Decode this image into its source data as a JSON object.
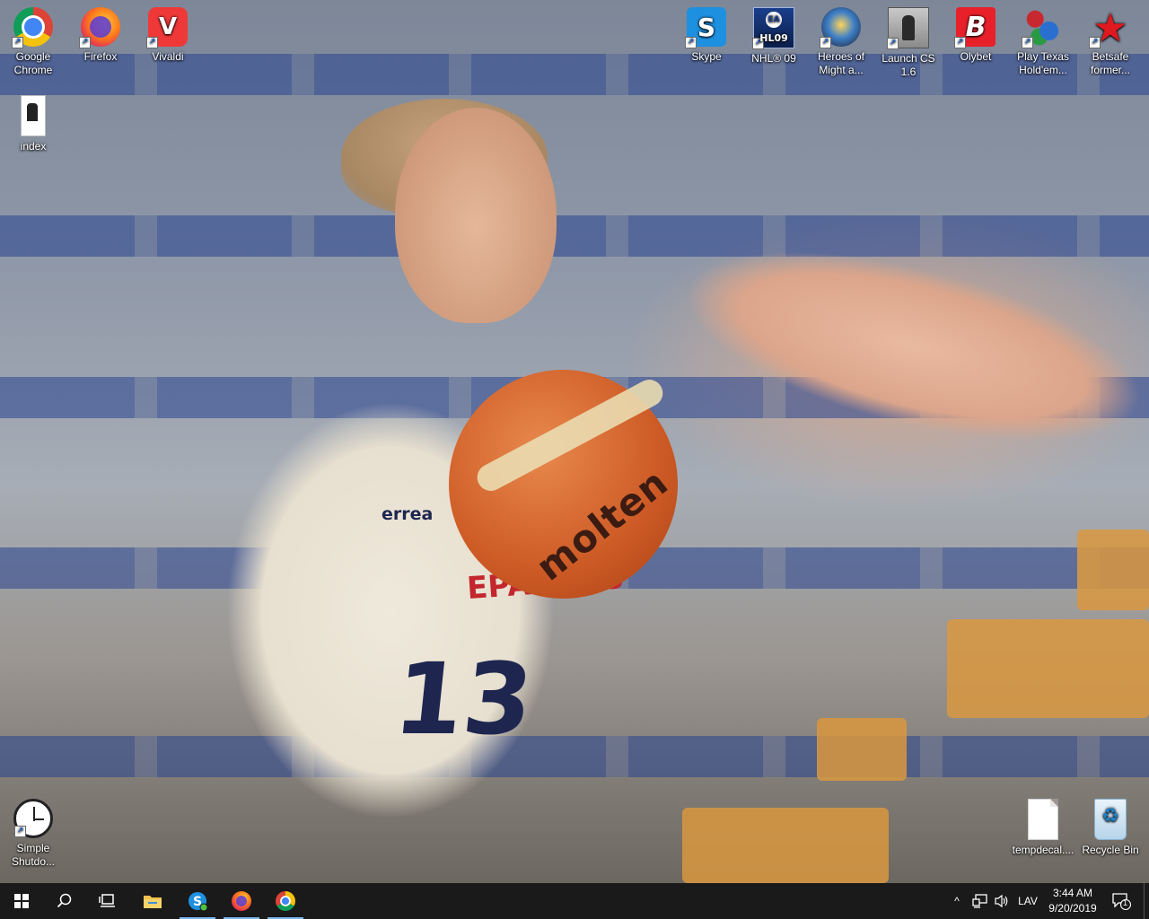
{
  "desktop": {
    "icons_top_left": [
      {
        "label": "Google Chrome",
        "icon": "chrome-icon"
      },
      {
        "label": "Firefox",
        "icon": "firefox-icon"
      },
      {
        "label": "Vivaldi",
        "icon": "vivaldi-icon"
      },
      {
        "label": "index",
        "icon": "document-icon"
      }
    ],
    "icons_top_right": [
      {
        "label": "Skype",
        "icon": "skype-icon"
      },
      {
        "label": "NHL® 09",
        "icon": "nhl09-icon"
      },
      {
        "label": "Heroes of Might a...",
        "icon": "heroes-icon"
      },
      {
        "label": "Launch CS 1.6",
        "icon": "counter-strike-icon"
      },
      {
        "label": "Olybet",
        "icon": "olybet-icon"
      },
      {
        "label": "Play Texas Hold'em...",
        "icon": "poker-chips-icon"
      },
      {
        "label": "Betsafe former...",
        "icon": "betsafe-icon"
      }
    ],
    "icons_bottom": [
      {
        "label": "Simple Shutdo...",
        "icon": "clock-icon"
      },
      {
        "label": "tempdecal....",
        "icon": "blank-file-icon"
      },
      {
        "label": "Recycle Bin",
        "icon": "recycle-bin-icon"
      }
    ],
    "wallpaper": {
      "jersey_brand": "errea",
      "jersey_team": "EPA LSSS",
      "jersey_number": "13",
      "ball_brand": "molten"
    }
  },
  "taskbar": {
    "pinned": [
      {
        "name": "start",
        "icon": "windows-logo-icon"
      },
      {
        "name": "search",
        "icon": "search-icon"
      },
      {
        "name": "task-view",
        "icon": "task-view-icon"
      },
      {
        "name": "file-explorer",
        "icon": "folder-icon"
      },
      {
        "name": "skype",
        "icon": "skype-icon"
      },
      {
        "name": "firefox",
        "icon": "firefox-icon"
      },
      {
        "name": "chrome",
        "icon": "chrome-icon"
      }
    ],
    "tray": {
      "chevron": "^",
      "language": "LAV",
      "time": "3:44 AM",
      "date": "9/20/2019",
      "notification_count": "1"
    },
    "accent": "#76b9ed",
    "background": "#1a1a1a"
  }
}
